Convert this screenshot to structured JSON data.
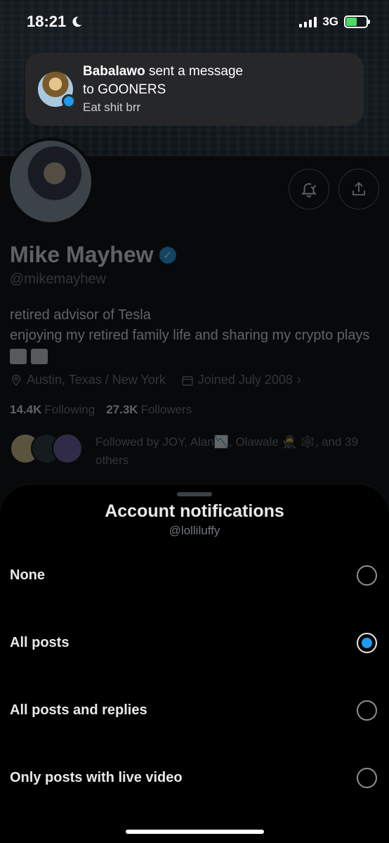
{
  "status_bar": {
    "time": "18:21",
    "network": "3G",
    "icons": [
      "moon-icon",
      "signal-icon",
      "battery-charging-icon"
    ]
  },
  "notification": {
    "sender": "Babalawo",
    "action_text": " sent a message",
    "target_text": "to GOONERS",
    "body": "Eat shit brr",
    "accent": "#1d9bf0"
  },
  "profile": {
    "name": "Mike Mayhew",
    "handle": "@mikemayhew",
    "bio_line1": "retired advisor of Tesla",
    "bio_line2": "enjoying my retired family life and sharing my crypto plays",
    "location": "Austin, Texas / New York",
    "joined": "Joined July 2008",
    "following_count": "14.4K",
    "following_label": "Following",
    "followers_count": "27.3K",
    "followers_label": "Followers",
    "followed_by": "Followed by JOY, Alan📉, Olawale 🥷 🕸️, and 39 others"
  },
  "sheet": {
    "title": "Account notifications",
    "subtitle": "@lolliluffy",
    "options": [
      {
        "label": "None",
        "selected": false
      },
      {
        "label": "All posts",
        "selected": true
      },
      {
        "label": "All posts and replies",
        "selected": false
      },
      {
        "label": "Only posts with live video",
        "selected": false
      }
    ]
  },
  "colors": {
    "accent": "#1d9bf0",
    "background": "#000000",
    "text_primary": "#e7e9ea",
    "text_secondary": "#71767b"
  }
}
